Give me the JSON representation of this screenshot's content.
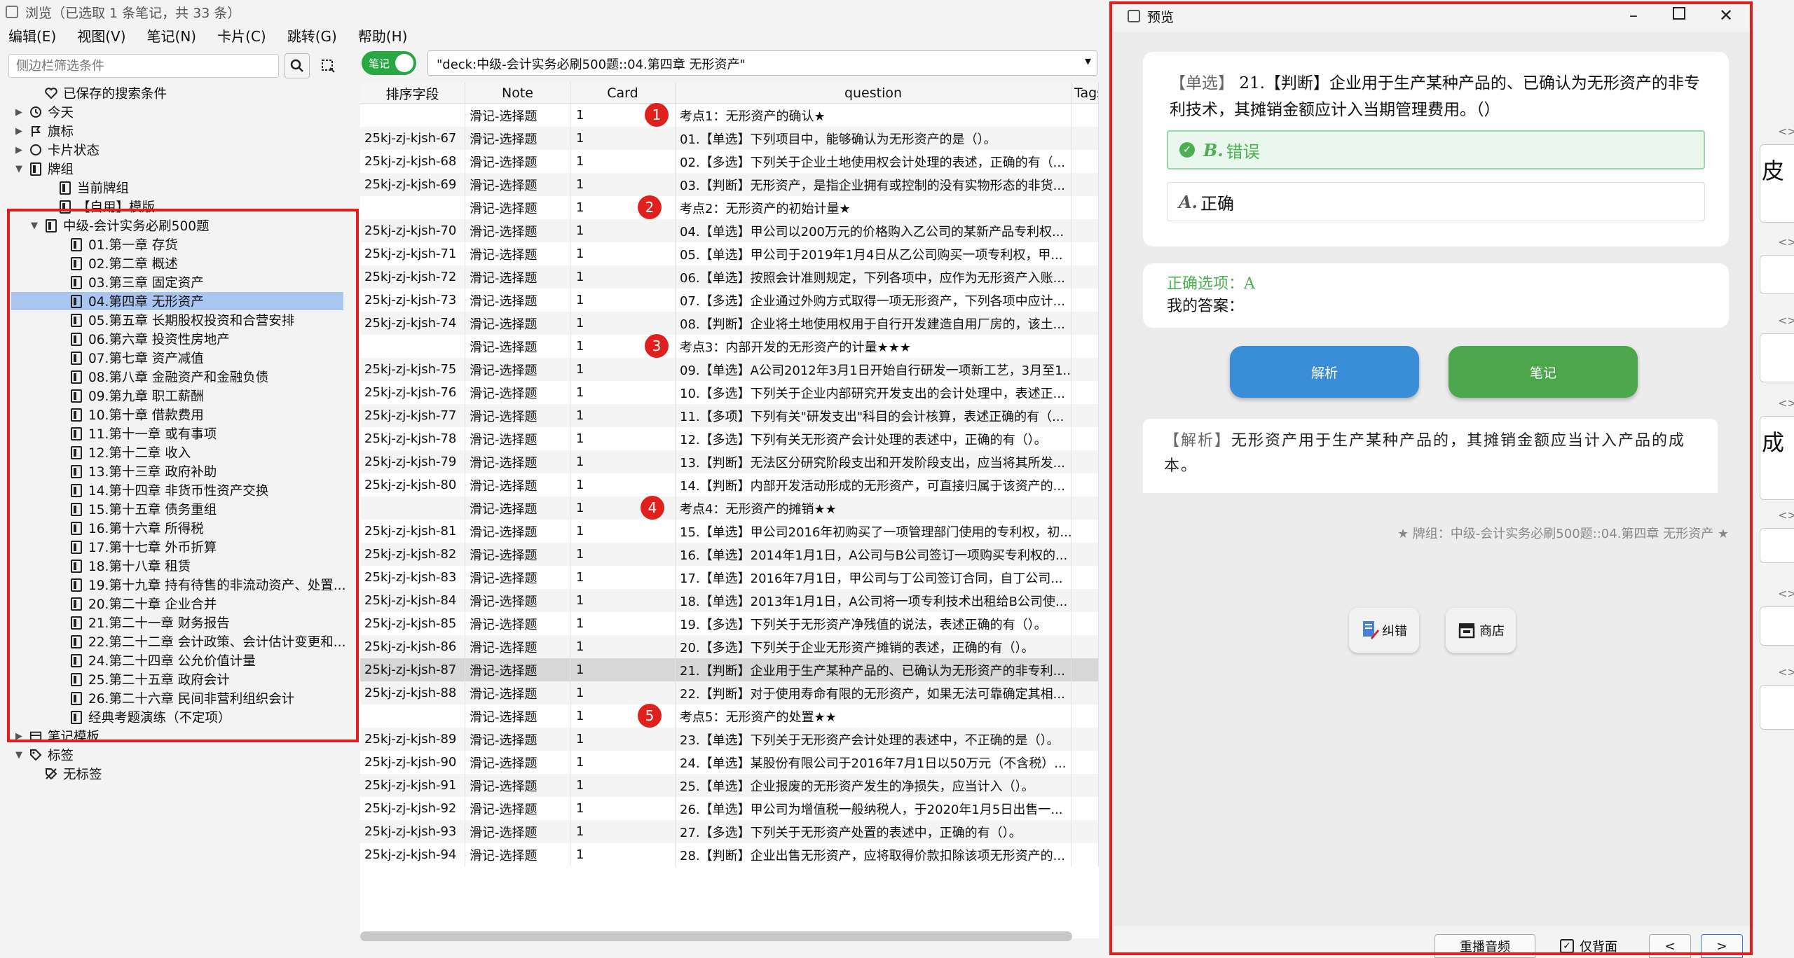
{
  "window": {
    "title": "浏览（已选取 1 条笔记，共 33 条）"
  },
  "menu": [
    "编辑(E)",
    "视图(V)",
    "笔记(N)",
    "卡片(C)",
    "跳转(G)",
    "帮助(H)"
  ],
  "sidebar": {
    "search_placeholder": "侧边栏筛选条件",
    "items": [
      {
        "label": "已保存的搜索条件",
        "icon": "heart-icon",
        "arrow": ""
      },
      {
        "label": "今天",
        "icon": "clock-icon",
        "arrow": "▶"
      },
      {
        "label": "旗标",
        "icon": "flag-icon",
        "arrow": "▶"
      },
      {
        "label": "卡片状态",
        "icon": "circle-icon",
        "arrow": "▶"
      },
      {
        "label": "牌组",
        "icon": "deck-icon",
        "arrow": "▼"
      },
      {
        "label": "当前牌组",
        "icon": "deck-icon",
        "arrow": ""
      },
      {
        "label": "【自用】模版",
        "icon": "deck-icon",
        "arrow": ""
      },
      {
        "label": "中级-会计实务必刷500题",
        "icon": "deck-icon",
        "arrow": "▼"
      }
    ],
    "chapters": [
      "01.第一章 存货",
      "02.第二章 概述",
      "03.第三章 固定资产",
      "04.第四章 无形资产",
      "05.第五章 长期股权投资和合营安排",
      "06.第六章 投资性房地产",
      "07.第七章 资产减值",
      "08.第八章 金融资产和金融负债",
      "09.第九章 职工薪酬",
      "10.第十章 借款费用",
      "11.第十一章 或有事项",
      "12.第十二章 收入",
      "13.第十三章 政府补助",
      "14.第十四章 非货币性资产交换",
      "15.第十五章 债务重组",
      "16.第十六章 所得税",
      "17.第十七章 外币折算",
      "18.第十八章 租赁",
      "19.第十九章 持有待售的非流动资产、处置...",
      "20.第二十章 企业合并",
      "21.第二十一章 财务报告",
      "22.第二十二章 会计政策、会计估计变更和...",
      "24.第二十四章 公允价值计量",
      "25.第二十五章 政府会计",
      "26.第二十六章 民间非营利组织会计",
      "经典考题演练（不定项）"
    ],
    "after": [
      {
        "label": "笔记模板",
        "icon": "notetype-icon",
        "arrow": "▶"
      },
      {
        "label": "标签",
        "icon": "tag-icon",
        "arrow": "▼"
      },
      {
        "label": "无标签",
        "icon": "untagged-icon",
        "arrow": ""
      }
    ]
  },
  "toolbar": {
    "toggle_label": "笔记",
    "search_value": "\"deck:中级-会计实务必刷500题::04.第四章 无形资产\""
  },
  "table": {
    "columns": [
      "排序字段",
      "Note",
      "Card",
      "question",
      "Tags"
    ],
    "rows": [
      {
        "sort": "",
        "note": "滑记-选择题",
        "card": "1",
        "q": "考点1：无形资产的确认★",
        "badge": "1"
      },
      {
        "sort": "25kj-zj-kjsh-67",
        "note": "滑记-选择题",
        "card": "1",
        "q": "01.【单选】下列项目中，能够确认为无形资产的是（）。"
      },
      {
        "sort": "25kj-zj-kjsh-68",
        "note": "滑记-选择题",
        "card": "1",
        "q": "02.【多选】下列关于企业土地使用权会计处理的表述，正确的有（..."
      },
      {
        "sort": "25kj-zj-kjsh-69",
        "note": "滑记-选择题",
        "card": "1",
        "q": "03.【判断】无形资产，是指企业拥有或控制的没有实物形态的非货..."
      },
      {
        "sort": "",
        "note": "滑记-选择题",
        "card": "1",
        "q": "考点2：无形资产的初始计量★",
        "badge": "2"
      },
      {
        "sort": "25kj-zj-kjsh-70",
        "note": "滑记-选择题",
        "card": "1",
        "q": "04.【单选】甲公司以200万元的价格购入乙公司的某新产品专利权..."
      },
      {
        "sort": "25kj-zj-kjsh-71",
        "note": "滑记-选择题",
        "card": "1",
        "q": "05.【单选】甲公司于2019年1月4日从乙公司购买一项专利权，甲..."
      },
      {
        "sort": "25kj-zj-kjsh-72",
        "note": "滑记-选择题",
        "card": "1",
        "q": "06.【单选】按照会计准则规定，下列各项中，应作为无形资产入账..."
      },
      {
        "sort": "25kj-zj-kjsh-73",
        "note": "滑记-选择题",
        "card": "1",
        "q": "07.【多选】企业通过外购方式取得一项无形资产，下列各项中应计..."
      },
      {
        "sort": "25kj-zj-kjsh-74",
        "note": "滑记-选择题",
        "card": "1",
        "q": "08.【判断】企业将土地使用权用于自行开发建造自用厂房的，该土..."
      },
      {
        "sort": "",
        "note": "滑记-选择题",
        "card": "1",
        "q": "考点3：内部开发的无形资产的计量★★★",
        "badge": "3"
      },
      {
        "sort": "25kj-zj-kjsh-75",
        "note": "滑记-选择题",
        "card": "1",
        "q": "09.【单选】A公司2012年3月1日开始自行研发一项新工艺，3月至1..."
      },
      {
        "sort": "25kj-zj-kjsh-76",
        "note": "滑记-选择题",
        "card": "1",
        "q": "10.【多选】下列关于企业内部研究开发支出的会计处理中，表述正..."
      },
      {
        "sort": "25kj-zj-kjsh-77",
        "note": "滑记-选择题",
        "card": "1",
        "q": "11.【多项】下列有关\"研发支出\"科目的会计核算，表述正确的有（..."
      },
      {
        "sort": "25kj-zj-kjsh-78",
        "note": "滑记-选择题",
        "card": "1",
        "q": "12.【多选】下列有关无形资产会计处理的表述中，正确的有（）。"
      },
      {
        "sort": "25kj-zj-kjsh-79",
        "note": "滑记-选择题",
        "card": "1",
        "q": "13.【判断】无法区分研究阶段支出和开发阶段支出，应当将其所发..."
      },
      {
        "sort": "25kj-zj-kjsh-80",
        "note": "滑记-选择题",
        "card": "1",
        "q": "14.【判断】内部开发活动形成的无形资产，可直接归属于该资产的..."
      },
      {
        "sort": "",
        "note": "滑记-选择题",
        "card": "1",
        "q": "考点4：无形资产的摊销★★",
        "badge": "4"
      },
      {
        "sort": "25kj-zj-kjsh-81",
        "note": "滑记-选择题",
        "card": "1",
        "q": "15.【单选】甲公司2016年初购买了一项管理部门使用的专利权，初..."
      },
      {
        "sort": "25kj-zj-kjsh-82",
        "note": "滑记-选择题",
        "card": "1",
        "q": "16.【单选】2014年1月1日，A公司与B公司签订一项购买专利权的..."
      },
      {
        "sort": "25kj-zj-kjsh-83",
        "note": "滑记-选择题",
        "card": "1",
        "q": "17.【单选】2016年7月1日，甲公司与丁公司签订合同，自丁公司..."
      },
      {
        "sort": "25kj-zj-kjsh-84",
        "note": "滑记-选择题",
        "card": "1",
        "q": "18.【单选】2013年1月1日，A公司将一项专利技术出租给B公司使..."
      },
      {
        "sort": "25kj-zj-kjsh-85",
        "note": "滑记-选择题",
        "card": "1",
        "q": "19.【多选】下列关于无形资产净残值的说法，表述正确的有（）。"
      },
      {
        "sort": "25kj-zj-kjsh-86",
        "note": "滑记-选择题",
        "card": "1",
        "q": "20.【多选】下列关于企业无形资产摊销的表述，正确的有（）。"
      },
      {
        "sort": "25kj-zj-kjsh-87",
        "note": "滑记-选择题",
        "card": "1",
        "q": "21.【判断】企业用于生产某种产品的、已确认为无形资产的非专利...",
        "selected": true
      },
      {
        "sort": "25kj-zj-kjsh-88",
        "note": "滑记-选择题",
        "card": "1",
        "q": "22.【判断】对于使用寿命有限的无形资产，如果无法可靠确定其相..."
      },
      {
        "sort": "",
        "note": "滑记-选择题",
        "card": "1",
        "q": "考点5：无形资产的处置★★",
        "badge": "5"
      },
      {
        "sort": "25kj-zj-kjsh-89",
        "note": "滑记-选择题",
        "card": "1",
        "q": "23.【单选】下列关于无形资产会计处理的表述中，不正确的是（）。"
      },
      {
        "sort": "25kj-zj-kjsh-90",
        "note": "滑记-选择题",
        "card": "1",
        "q": "24.【单选】某股份有限公司于2016年7月1日以50万元（不含税）..."
      },
      {
        "sort": "25kj-zj-kjsh-91",
        "note": "滑记-选择题",
        "card": "1",
        "q": "25.【单选】企业报废的无形资产发生的净损失，应当计入（）。"
      },
      {
        "sort": "25kj-zj-kjsh-92",
        "note": "滑记-选择题",
        "card": "1",
        "q": "26.【单选】甲公司为增值税一般纳税人，于2020年1月5日出售一..."
      },
      {
        "sort": "25kj-zj-kjsh-93",
        "note": "滑记-选择题",
        "card": "1",
        "q": "27.【多选】下列关于无形资产处置的表述中，正确的有（）。"
      },
      {
        "sort": "25kj-zj-kjsh-94",
        "note": "滑记-选择题",
        "card": "1",
        "q": "28.【判断】企业出售无形资产，应将取得价款扣除该项无形资产的..."
      }
    ]
  },
  "preview": {
    "title": "预览",
    "question_tag": "【单选】",
    "question_text": "21.【判断】企业用于生产某种产品的、已确认为无形资产的非专利技术，其摊销金额应计入当期管理费用。（）",
    "option_correct_letter": "B.",
    "option_correct_text": "错误",
    "option_other_letter": "A.",
    "option_other_text": "正确",
    "correct_answer": "正确选项：A",
    "my_answer": "我的答案：",
    "btn_analysis": "解析",
    "btn_note": "笔记",
    "analysis_tag": "【解析】",
    "analysis_text": "无形资产用于生产某种产品的，其摊销金额应当计入产品的成本。",
    "deck_info": "★ 牌组：中级-会计实务必刷500题::04.第四章 无形资产 ★",
    "tool_correct": "纠错",
    "tool_shop": "商店",
    "footer_replay": "重播音频",
    "footer_back_only": "仅背面",
    "footer_prev": "<",
    "footer_next": ">"
  },
  "right_strip": {
    "char1": "皮",
    "char2": "成"
  }
}
